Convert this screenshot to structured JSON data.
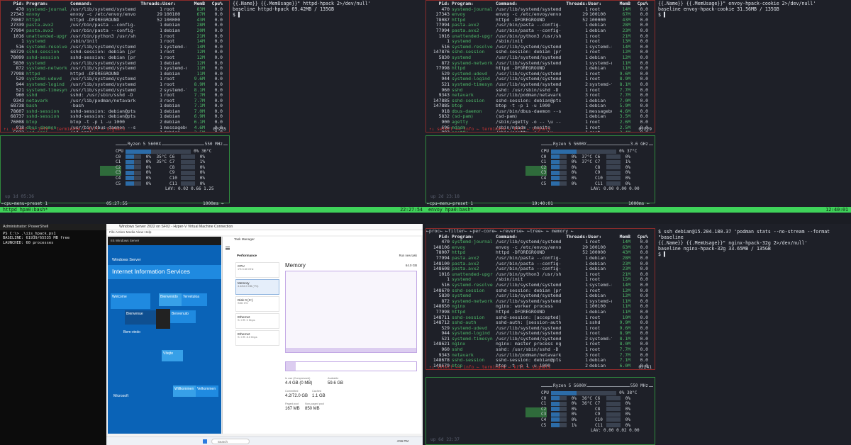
{
  "q1": {
    "right_lines": [
      "{{.Name}} {{.MemUsage}}\" httpd-hpack 2>/dev/null'",
      "baseline httpd-hpack 69.42MB / 135GB",
      "$ ▌"
    ],
    "header": [
      "Pid:",
      "Program:",
      "Command:",
      "Threads:",
      "User:",
      "MemB",
      "Cpu%"
    ],
    "rows": [
      [
        "470",
        "systemd-journal",
        "/usr/lib/systemd/systemd",
        "1",
        "root",
        "83M",
        "0.0"
      ],
      [
        "27343",
        "envoy",
        "envoy -c /etc/envoy/envo",
        "29",
        "100100",
        "67M",
        "0.0"
      ],
      [
        "78087",
        "httpd",
        "httpd -DFOREGROUND",
        "52",
        "100000",
        "43M",
        "0.0"
      ],
      [
        "27339",
        "pasta.avx2",
        "/usr/bin/pasta --config-",
        "1",
        "debian",
        "28M",
        "0.0"
      ],
      [
        "77994",
        "pasta.avx2",
        "/usr/bin/pasta --config-",
        "1",
        "debian",
        "20M",
        "0.0"
      ],
      [
        "1016",
        "unattended-upgr",
        "/usr/bin/python3 /usr/sh",
        "1",
        "root",
        "21M",
        "0.0"
      ],
      [
        "1",
        "systemd",
        "/sbin/init",
        "1",
        "root",
        "14M",
        "0.0"
      ],
      [
        "516",
        "systemd-resolve",
        "/usr/lib/systemd/systemd",
        "1",
        "systemd-r+",
        "14M",
        "0.0"
      ],
      [
        "68729",
        "sshd-session",
        "sshd-session: debian [pr",
        "1",
        "root",
        "12M",
        "0.0"
      ],
      [
        "78099",
        "sshd-session",
        "sshd-session: debian [pr",
        "1",
        "root",
        "12M",
        "0.0"
      ],
      [
        "5830",
        "systemd",
        "/usr/lib/systemd/systemd",
        "1",
        "debian",
        "12M",
        "0.0"
      ],
      [
        "872",
        "systemd-network",
        "/usr/lib/systemd/systemd",
        "1",
        "systemd-n+",
        "11M",
        "0.0"
      ],
      [
        "77998",
        "httpd",
        "httpd -DFOREGROUND",
        "1",
        "debian",
        "11M",
        "0.0"
      ],
      [
        "529",
        "systemd-udevd",
        "/usr/lib/systemd/systemd",
        "1",
        "root",
        "9.6M",
        "0.0"
      ],
      [
        "944",
        "systemd-logind",
        "/usr/lib/systemd/systemd",
        "1",
        "root",
        "8.9M",
        "0.0"
      ],
      [
        "521",
        "systemd-timesyn",
        "/usr/lib/systemd/systemd",
        "2",
        "systemd-t+",
        "8.1M",
        "0.0"
      ],
      [
        "960",
        "sshd",
        "sshd: /usr/sbin/sshd -D",
        "1",
        "root",
        "7.7M",
        "0.0"
      ],
      [
        "9343",
        "netavark",
        "/usr/lib/podman/netavark",
        "3",
        "root",
        "7.7M",
        "0.0"
      ],
      [
        "68738",
        "bash",
        "-bash",
        "1",
        "debian",
        "7.1M",
        "0.0"
      ],
      [
        "78607",
        "sshd-session",
        "sshd-session: debian@pts",
        "1",
        "debian",
        "7.0M",
        "0.0"
      ],
      [
        "68737",
        "sshd-session",
        "sshd-session: debian@pts",
        "1",
        "debian",
        "6.9M",
        "0.0"
      ],
      [
        "76008",
        "btop",
        "btop -t -p 1 -u 1000",
        "2",
        "debian",
        "6.1M",
        "0.0"
      ],
      [
        "918",
        "dbus-daemon",
        "/usr/bin/dbus-daemon --s",
        "1",
        "messagebus",
        "4.6M",
        "0.0"
      ],
      [
        "5832",
        "(sd-pam)",
        "(sd-pam)",
        "1",
        "debian",
        "3.5M",
        "0.0"
      ]
    ],
    "footer": "↑↓ select ←→ info ← terminate ← kill ← signals",
    "count": "0/235",
    "cpu_model": "Ryzen 5 5600X",
    "cpu_freq": "550 MHz",
    "cpu_total": "0%",
    "cpu_temp": "36°C",
    "cores": [
      [
        "C0",
        "0%",
        "35°C",
        "C6",
        "0%"
      ],
      [
        "C1",
        "0%",
        "35°C",
        "C7",
        "1%"
      ],
      [
        "C2",
        "0%",
        "",
        "C8",
        "0%"
      ],
      [
        "C3",
        "0%",
        "",
        "C9",
        "0%"
      ],
      [
        "C4",
        "0%",
        "",
        "C10",
        "0%"
      ],
      [
        "C5",
        "0%",
        "",
        "C11",
        "0%"
      ]
    ],
    "lav": "LAV: 0.02 0.66 1.25",
    "up": "up 1d 05:36",
    "bottom_left": "←cpu←menu←preset 1",
    "clock": "05:27:55",
    "rate": "1000ms ←",
    "status": "httpd hpa0:bash*",
    "status_time": "22:27:54"
  },
  "q2": {
    "right_lines": [
      "{{.Name}} {{.MemUsage}}\" envoy-hpack-cookie 2>/dev/null'",
      "baseline envoy-hpack-cookie 31.56MB / 135GB",
      "$ ▌"
    ],
    "rows": [
      [
        "470",
        "systemd-journal",
        "/usr/lib/systemd/systemd",
        "1",
        "root",
        "14M",
        "0.0"
      ],
      [
        "27343",
        "envoy",
        "envoy -c /etc/envoy/envo",
        "29",
        "100100",
        "67M",
        "0.0"
      ],
      [
        "78087",
        "httpd",
        "httpd -DFOREGROUND",
        "52",
        "100000",
        "43M",
        "0.0"
      ],
      [
        "77994",
        "pasta.avx2",
        "/usr/bin/pasta --config-",
        "1",
        "debian",
        "28M",
        "0.0"
      ],
      [
        "77994",
        "pasta.avx2",
        "/usr/bin/pasta --config-",
        "1",
        "debian",
        "23M",
        "0.0"
      ],
      [
        "1016",
        "unattended-upgr",
        "/usr/bin/python3 /usr/sh",
        "1",
        "root",
        "21M",
        "0.0"
      ],
      [
        "1",
        "systemd",
        "/sbin/init",
        "1",
        "root",
        "13M",
        "0.0"
      ],
      [
        "516",
        "systemd-resolve",
        "/usr/lib/systemd/systemd",
        "1",
        "systemd-r+",
        "14M",
        "0.0"
      ],
      [
        "147876",
        "sshd-session",
        "sshd-session: debian [pr",
        "1",
        "root",
        "12M",
        "0.0"
      ],
      [
        "5830",
        "systemd",
        "/usr/lib/systemd/systemd",
        "1",
        "debian",
        "12M",
        "0.0"
      ],
      [
        "872",
        "systemd-network",
        "/usr/lib/systemd/systemd",
        "1",
        "systemd-n+",
        "11M",
        "0.0"
      ],
      [
        "77998",
        "httpd",
        "httpd -DFOREGROUND",
        "1",
        "debian",
        "11M",
        "0.0"
      ],
      [
        "529",
        "systemd-udevd",
        "/usr/lib/systemd/systemd",
        "1",
        "root",
        "9.6M",
        "0.0"
      ],
      [
        "944",
        "systemd-logind",
        "/usr/lib/systemd/systemd",
        "1",
        "root",
        "8.9M",
        "0.0"
      ],
      [
        "521",
        "systemd-timesyn",
        "/usr/lib/systemd/systemd",
        "2",
        "systemd-t+",
        "8.1M",
        "0.0"
      ],
      [
        "960",
        "sshd",
        "sshd: /usr/sbin/sshd -D",
        "1",
        "root",
        "7.7M",
        "0.0"
      ],
      [
        "9343",
        "netavark",
        "/usr/lib/podman/netavark",
        "3",
        "root",
        "7.7M",
        "0.0"
      ],
      [
        "147885",
        "sshd-session",
        "sshd-session: debian@pts",
        "1",
        "debian",
        "7.0M",
        "0.0"
      ],
      [
        "147885",
        "btop",
        "btop -t -p 1 -u 1000",
        "1",
        "debian",
        "5.9M",
        "0.0"
      ],
      [
        "918",
        "dbus-daemon",
        "/usr/bin/dbus-daemon --s",
        "1",
        "messagebus",
        "4.6M",
        "0.0"
      ],
      [
        "5832",
        "(sd-pam)",
        "(sd-pam)",
        "1",
        "debian",
        "3.5M",
        "0.0"
      ],
      [
        "900",
        "agetty",
        "/sbin/agetty -o -- \\u --",
        "1",
        "root",
        "2.6M",
        "0.0"
      ],
      [
        "696",
        "mdadm",
        "/sbin/mdadm --monito",
        "1",
        "root",
        "2.5M",
        "0.0"
      ],
      [
        "982",
        "agetty",
        "/sbin/agetty -o -- \\u --",
        "1",
        "root",
        "2.4M",
        "0.0"
      ]
    ],
    "count": "0/229",
    "cpu_freq": "3.6 GHz",
    "cpu_total": "0%",
    "cpu_temp": "37°C",
    "cores": [
      [
        "C0",
        "0%",
        "37°C",
        "C6",
        "0%"
      ],
      [
        "C1",
        "0%",
        "37°C",
        "C7",
        "1%"
      ],
      [
        "C2",
        "0%",
        "",
        "C8",
        "0%"
      ],
      [
        "C3",
        "0%",
        "",
        "C9",
        "0%"
      ],
      [
        "C4",
        "0%",
        "",
        "C10",
        "0%"
      ],
      [
        "C5",
        "0%",
        "",
        "C11",
        "0%"
      ]
    ],
    "lav": "LAV: 0.00 0.00 0.00",
    "up": "up 2d 23:18",
    "clock": "19:40:01",
    "status": "envoy hpa0:bash*",
    "status_time": "12:40:01"
  },
  "q3": {
    "ps_title": "Administrator: PowerShell",
    "ps_lines": [
      "PS C:\\> .\\iis_hpack.ps1",
      "BASELINE: 61939/65535 MB free",
      "LAUNCHED: 60 processes"
    ],
    "rdp_title": "Windows Server 2022 on SF02 - Hyper-V Virtual Machine Connection",
    "rdp_menu": "File  Action  Media  View  Help",
    "ws_title": "Windows Server",
    "iis_title": "Internet Information Services",
    "tiles": [
      "Welcome",
      "Bienvenido",
      "Tervetuloa",
      "Bienvenue",
      "Benvenuto",
      "Bem-vindo",
      "Vítejte",
      "Willkommen",
      "Velkommen"
    ],
    "microsoft": "Microsoft",
    "tm_title": "Task Manager",
    "tm_section": "Performance",
    "tm_items": [
      [
        "CPU",
        "1% 3.60 GHz"
      ],
      [
        "Memory",
        "4.4/64.0 GB (7%)"
      ],
      [
        "Disk 0 (C:)",
        "SSD 0%"
      ],
      [
        "Ethernet",
        "S: 0 R: 0 Kbps"
      ],
      [
        "Ethernet",
        "S: 0 R: 8.0 Kbps"
      ]
    ],
    "mem_title": "Memory",
    "mem_total": "64.0 GB",
    "in_use_label": "In use (Compressed)",
    "in_use": "4.4 GB (0 MB)",
    "available_label": "Available",
    "available": "59.6 GB",
    "committed_label": "Committed",
    "committed": "4.2/72.0 GB",
    "cached_label": "Cached",
    "cached": "1.1 GB",
    "paged_label": "Paged pool",
    "paged": "167 MB",
    "nonpaged_label": "Non-paged pool",
    "nonpaged": "850 MB",
    "run_task": "Run new task",
    "search": "Search",
    "taskbar_time": "4:56 PM"
  },
  "q4": {
    "tabs": "←proc← ←filter← ←per-core← ←reverse← ←tree← ← memory ←",
    "right_lines": [
      "$ ssh debian@15.204.180.37 'podman stats --no-stream --format \"baseline",
      "{{.Name}} {{.MemUsage}}\" nginx-hpack-32g 2>/dev/null'",
      "baseline nginx-hpack-32g 33.65MB / 135GB",
      "$ ▌"
    ],
    "rows": [
      [
        "470",
        "systemd-journal",
        "/usr/lib/systemd/systemd",
        "1",
        "root",
        "14M",
        "0.0"
      ],
      [
        "148106",
        "envoy",
        "envoy -c /etc/envoy/envo",
        "29",
        "100100",
        "63M",
        "0.0"
      ],
      [
        "78007",
        "httpd",
        "httpd -DFOREGROUND",
        "52",
        "100000",
        "43M",
        "0.0"
      ],
      [
        "77994",
        "pasta.avx2",
        "/usr/bin/pasta --config-",
        "1",
        "debian",
        "28M",
        "0.0"
      ],
      [
        "148100",
        "pasta.avx2",
        "/usr/bin/pasta --config-",
        "1",
        "debian",
        "23M",
        "0.0"
      ],
      [
        "148608",
        "pasta.avx2",
        "/usr/bin/pasta --config-",
        "1",
        "debian",
        "23M",
        "0.0"
      ],
      [
        "1016",
        "unattended-upgr",
        "/usr/bin/python3 /usr/sh",
        "1",
        "root",
        "21M",
        "0.0"
      ],
      [
        "1",
        "systemd",
        "/sbin/init",
        "1",
        "root",
        "15M",
        "0.0"
      ],
      [
        "516",
        "systemd-resolve",
        "/usr/lib/systemd/systemd",
        "1",
        "systemd-r+",
        "14M",
        "0.0"
      ],
      [
        "148670",
        "sshd-session",
        "sshd-session: debian [pr",
        "1",
        "root",
        "12M",
        "0.0"
      ],
      [
        "5830",
        "systemd",
        "/usr/lib/systemd/systemd",
        "1",
        "debian",
        "12M",
        "0.0"
      ],
      [
        "872",
        "systemd-network",
        "/usr/lib/systemd/systemd",
        "1",
        "systemd-n+",
        "11M",
        "0.0"
      ],
      [
        "148650",
        "nginx",
        "nginx: worker process",
        "1",
        "100100",
        "11M",
        "0.0"
      ],
      [
        "77998",
        "httpd",
        "httpd -DFOREGROUND",
        "1",
        "debian",
        "11M",
        "0.0"
      ],
      [
        "148711",
        "sshd-session",
        "sshd-session: [accepted]",
        "1",
        "root",
        "10M",
        "0.0"
      ],
      [
        "148712",
        "sshd-auth",
        "sshd-auth: [session-auth",
        "1",
        "sshd",
        "9.9M",
        "0.0"
      ],
      [
        "529",
        "systemd-udevd",
        "/usr/lib/systemd/systemd",
        "1",
        "root",
        "9.6M",
        "0.0"
      ],
      [
        "944",
        "systemd-logind",
        "/usr/lib/systemd/systemd",
        "1",
        "root",
        "8.9M",
        "0.0"
      ],
      [
        "521",
        "systemd-timesyn",
        "/usr/lib/systemd/systemd",
        "2",
        "systemd-t+",
        "8.1M",
        "0.0"
      ],
      [
        "148621",
        "nginx",
        "nginx: master process ng",
        "1",
        "root",
        "8.0M",
        "0.0"
      ],
      [
        "960",
        "sshd",
        "sshd: /usr/sbin/sshd -D",
        "1",
        "root",
        "7.7M",
        "0.0"
      ],
      [
        "9343",
        "netavark",
        "/usr/lib/podman/netavark",
        "3",
        "root",
        "7.7M",
        "0.0"
      ],
      [
        "148678",
        "sshd-session",
        "sshd-session: debian@pts",
        "1",
        "debian",
        "7.1M",
        "0.0"
      ],
      [
        "148679",
        "btop",
        "btop -t -p 1 -u 1000",
        "2",
        "debian",
        "6.0M",
        "0.0"
      ]
    ],
    "count": "0/241",
    "cpu_freq": "550 MHz",
    "cpu_total": "0%",
    "cpu_temp": "38°C",
    "cores": [
      [
        "C0",
        "0%",
        "36°C",
        "C6",
        "0%"
      ],
      [
        "C1",
        "0%",
        "36°C",
        "C7",
        "0%"
      ],
      [
        "C2",
        "0%",
        "",
        "C8",
        "0%"
      ],
      [
        "C3",
        "0%",
        "",
        "C9",
        "0%"
      ],
      [
        "C4",
        "0%",
        "",
        "C10",
        "0%"
      ],
      [
        "C5",
        "1%",
        "",
        "C11",
        "0%"
      ]
    ],
    "lav": "LAV: 0.00 0.02 0.00",
    "up": "up 6d 22:37"
  },
  "colors": {
    "green": "#3fd35a",
    "red_border": "#8a2b2b",
    "prog_green": "#4fb86a",
    "bar_blue": "#2c6ca8",
    "win_blue": "#0a63b7"
  }
}
